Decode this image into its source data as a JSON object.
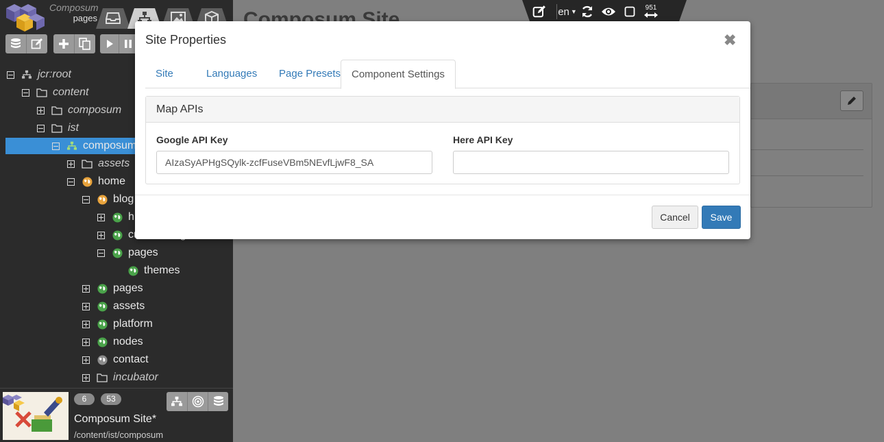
{
  "sidebar": {
    "brand": {
      "name": "Composum",
      "section": "pages"
    },
    "nav_tabs": [
      {
        "icon": "inbox-icon"
      },
      {
        "icon": "sitemap-icon"
      },
      {
        "icon": "image-icon"
      },
      {
        "icon": "cube-icon"
      }
    ],
    "toolbar": [
      {
        "icon": "database-icon"
      },
      {
        "icon": "edit-icon"
      },
      {
        "icon": "plus-icon"
      },
      {
        "icon": "copy-icon"
      },
      {
        "icon": "play-icon"
      },
      {
        "icon": "pause-icon"
      }
    ],
    "tree": [
      {
        "label": "jcr:root",
        "toggle": "minus",
        "icon": "sitemap-icon"
      },
      {
        "label": "content",
        "toggle": "minus",
        "icon": "folder-icon"
      },
      {
        "label": "composum",
        "toggle": "plus",
        "icon": "folder-icon"
      },
      {
        "label": "ist",
        "toggle": "minus",
        "icon": "folder-icon"
      },
      {
        "label": "composum",
        "toggle": "minus",
        "icon": "site-icon"
      },
      {
        "label": "assets",
        "toggle": "plus",
        "icon": "folder-icon"
      },
      {
        "label": "home",
        "toggle": "minus",
        "icon": "globe-orange-icon"
      },
      {
        "label": "blog",
        "toggle": "minus",
        "icon": "globe-orange-icon"
      },
      {
        "label": "h",
        "toggle": "plus",
        "icon": "globe-green-icon"
      },
      {
        "label": "customizing",
        "toggle": "plus",
        "icon": "globe-green-icon"
      },
      {
        "label": "pages",
        "toggle": "minus",
        "icon": "globe-green-icon"
      },
      {
        "label": "themes",
        "toggle": "none",
        "icon": "globe-green-icon"
      },
      {
        "label": "pages",
        "toggle": "plus",
        "icon": "globe-green-icon"
      },
      {
        "label": "assets",
        "toggle": "plus",
        "icon": "globe-green-icon"
      },
      {
        "label": "platform",
        "toggle": "plus",
        "icon": "globe-green-icon"
      },
      {
        "label": "nodes",
        "toggle": "plus",
        "icon": "globe-green-icon"
      },
      {
        "label": "contact",
        "toggle": "plus",
        "icon": "globe-gray-icon"
      },
      {
        "label": "incubator",
        "toggle": "plus",
        "icon": "folder-icon"
      }
    ],
    "footer": {
      "badge_1": "6",
      "badge_2": "53",
      "title": "Composum Site*",
      "path": "/content/ist/composum"
    }
  },
  "main": {
    "page_title": "Composum Site"
  },
  "topbar": {
    "language": "en",
    "width_value": "951"
  },
  "modal": {
    "title": "Site Properties",
    "tabs": [
      "Site",
      "Languages",
      "Page Presets",
      "Component Settings"
    ],
    "active_tab": "Component Settings",
    "panel_title": "Map APIs",
    "google_label": "Google API Key",
    "google_value": "AIzaSyAPHgSQylk-zcfFuseVBm5NEvfLjwF8_SA",
    "here_label": "Here API Key",
    "here_value": "",
    "cancel_label": "Cancel",
    "save_label": "Save"
  },
  "colors": {
    "accent": "#337ab7",
    "selection": "#3a8fd6",
    "sidebar_bg": "#2b2b2b"
  }
}
